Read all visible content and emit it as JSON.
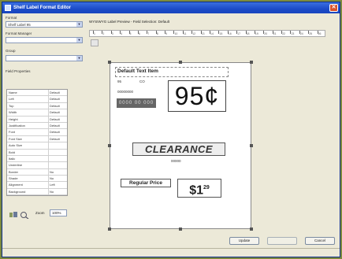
{
  "window": {
    "title": "Shelf Label Format Editor",
    "close_glyph": "✕"
  },
  "left": {
    "label1": "Format",
    "combo1": "Shelf Label 95",
    "label2": "Format Manager",
    "combo2": "",
    "label3": "Group",
    "combo3": "",
    "label4": "Field Properties",
    "properties": [
      {
        "k": "Name",
        "v": "Default"
      },
      {
        "k": "Left",
        "v": "Default"
      },
      {
        "k": "Top",
        "v": "Default"
      },
      {
        "k": "Width",
        "v": "Default"
      },
      {
        "k": "Height",
        "v": "Default"
      },
      {
        "k": "Justification",
        "v": "Default"
      },
      {
        "k": "Font",
        "v": "Default"
      },
      {
        "k": "Font Size",
        "v": "Default"
      },
      {
        "k": "Auto Size",
        "v": ""
      },
      {
        "k": "Bold",
        "v": ""
      },
      {
        "k": "Italic",
        "v": ""
      },
      {
        "k": "Underline",
        "v": ""
      },
      {
        "k": "Border",
        "v": "No"
      },
      {
        "k": "Shade",
        "v": "No"
      },
      {
        "k": "Alignment",
        "v": "Left"
      },
      {
        "k": "Background",
        "v": "No"
      }
    ],
    "zoom_label": "Zoom",
    "zoom_value": "100%"
  },
  "ruler": {
    "label": "WYSIWYG Label Preview - Field Selection: Default",
    "numbers": [
      "1",
      "2",
      "3",
      "4",
      "5",
      "6",
      "7",
      "8",
      "9",
      "10",
      "11",
      "12",
      "13",
      "14",
      "15",
      "16",
      "17",
      "18",
      "19",
      "20",
      "21",
      "22",
      "23",
      "24",
      "25",
      "26"
    ]
  },
  "label": {
    "title": "Default Text Item",
    "sub1": "95",
    "sub2": "CO",
    "code": "00000000",
    "barcode": "0000 00 000",
    "price": "95¢",
    "clearance": "CLEARANCE",
    "clearance_sub": "00000",
    "reg_label": "Regular Price",
    "reg_price": "$1",
    "reg_cents": "29"
  },
  "buttons": {
    "update": "Update",
    "apply": "",
    "cancel": "Cancel"
  },
  "colors": {
    "titlebar": "#1c4bc8",
    "window_bg": "#ece9d8",
    "frame": "#7d8a3e"
  }
}
